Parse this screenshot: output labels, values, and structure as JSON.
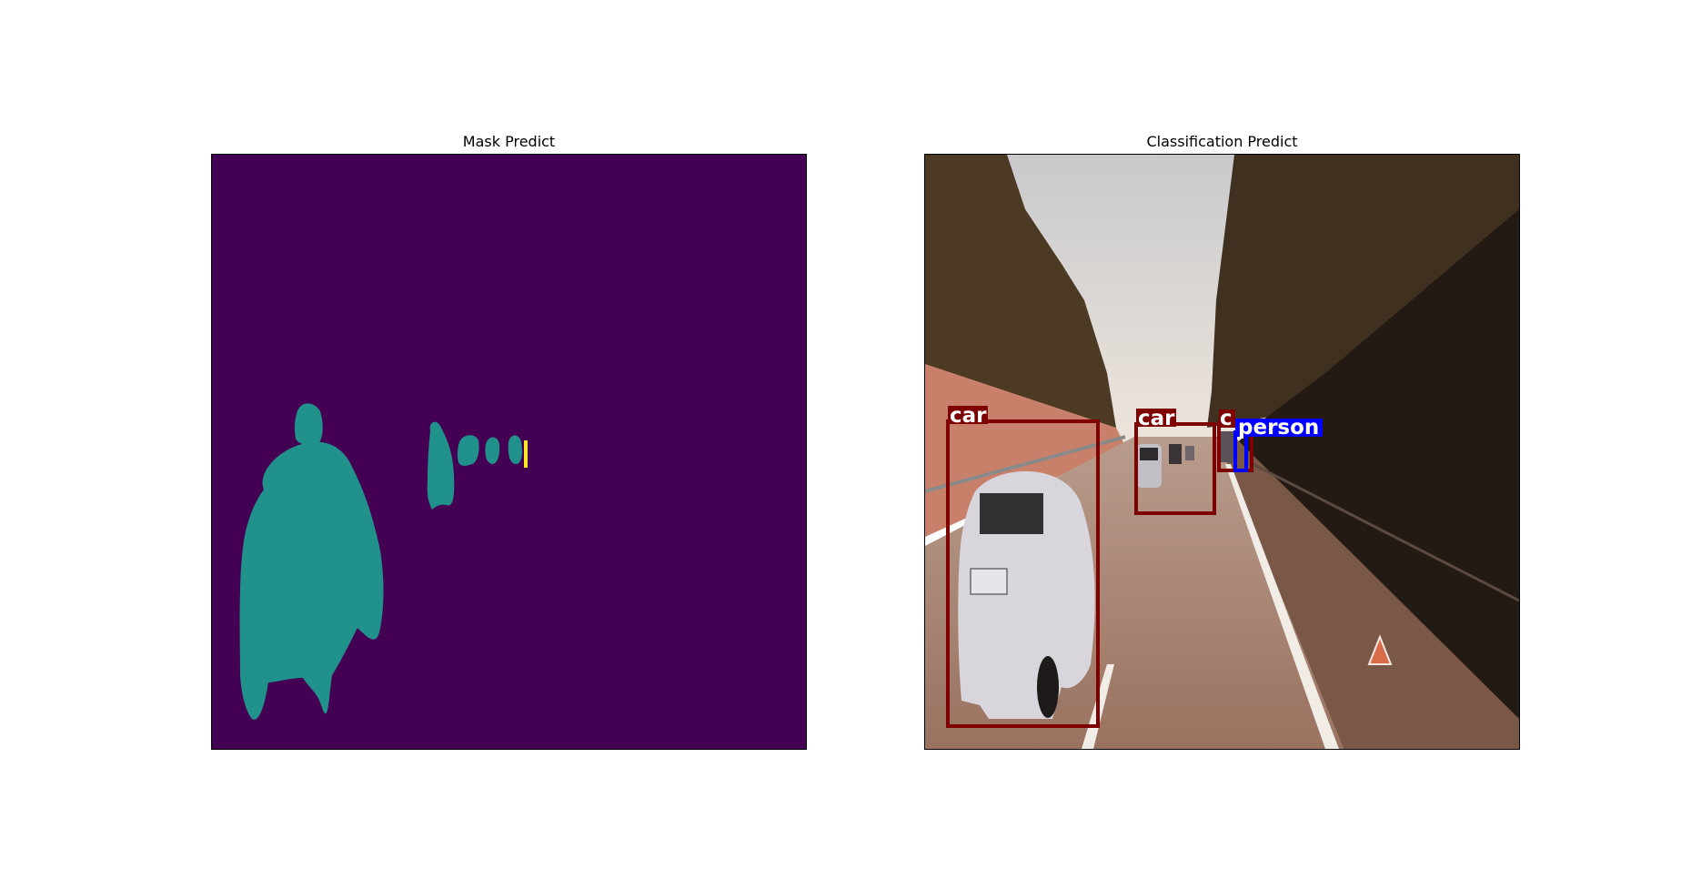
{
  "figure": {
    "left_title": "Mask Predict",
    "right_title": "Classification Predict"
  },
  "mask": {
    "background_color": "#440154",
    "class_color_1": "#21918c",
    "class_color_2": "#fde725"
  },
  "detections": [
    {
      "label": "car",
      "color": "#7f0000"
    },
    {
      "label": "car",
      "color": "#7f0000"
    },
    {
      "label": "c",
      "color": "#7f0000"
    },
    {
      "label": "person",
      "color": "#0000ff"
    }
  ]
}
